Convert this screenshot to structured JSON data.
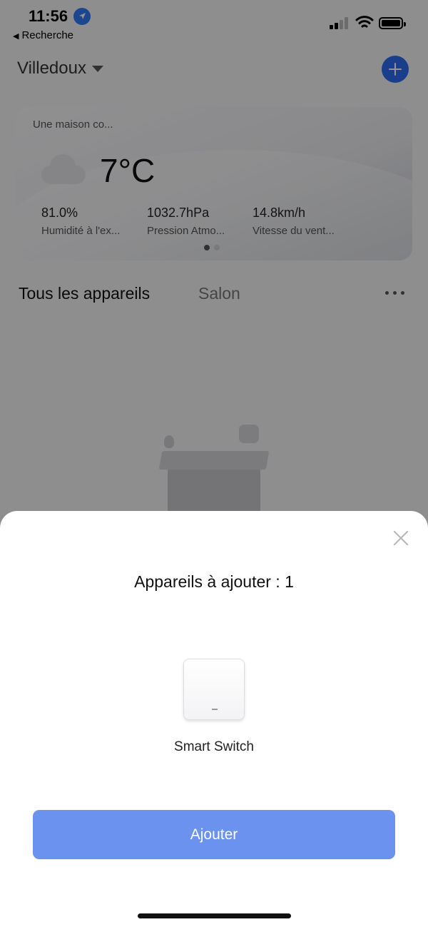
{
  "status_bar": {
    "time": "11:56",
    "back_label": "Recherche"
  },
  "header": {
    "home_name": "Villedoux",
    "add_icon": "plus-icon"
  },
  "weather": {
    "home_label": "Une maison co...",
    "temperature": "7°C",
    "condition_icon": "cloud-icon",
    "stats": [
      {
        "value": "81.0%",
        "label": "Humidité à l'ex..."
      },
      {
        "value": "1032.7hPa",
        "label": "Pression Atmo..."
      },
      {
        "value": "14.8km/h",
        "label": "Vitesse du vent..."
      }
    ]
  },
  "tabs": {
    "all": "Tous les appareils",
    "room": "Salon"
  },
  "sheet": {
    "title": "Appareils à ajouter : 1",
    "device_name": "Smart Switch",
    "add_button": "Ajouter"
  },
  "colors": {
    "accent": "#2d6cf0",
    "button": "#6b92ef"
  }
}
